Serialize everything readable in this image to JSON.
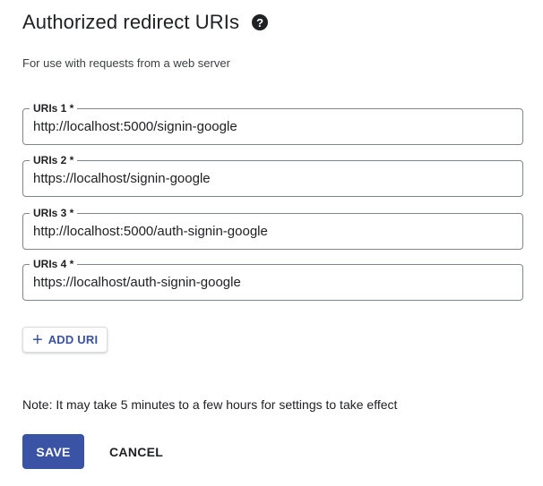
{
  "header": {
    "title": "Authorized redirect URIs",
    "help_icon": "help-circle-icon",
    "help_glyph": "?",
    "subtitle": "For use with requests from a web server"
  },
  "uris": [
    {
      "label": "URIs 1 *",
      "value": "http://localhost:5000/signin-google"
    },
    {
      "label": "URIs 2 *",
      "value": "https://localhost/signin-google"
    },
    {
      "label": "URIs 3 *",
      "value": "http://localhost:5000/auth-signin-google"
    },
    {
      "label": "URIs 4 *",
      "value": "https://localhost/auth-signin-google"
    }
  ],
  "add_uri": {
    "icon": "plus-icon",
    "glyph": "+",
    "label": "ADD URI"
  },
  "note": "Note: It may take 5 minutes to a few hours for settings to take effect",
  "actions": {
    "save_label": "SAVE",
    "cancel_label": "CANCEL"
  },
  "colors": {
    "accent": "#3a53a4",
    "text": "#202124",
    "border": "#80868b"
  }
}
